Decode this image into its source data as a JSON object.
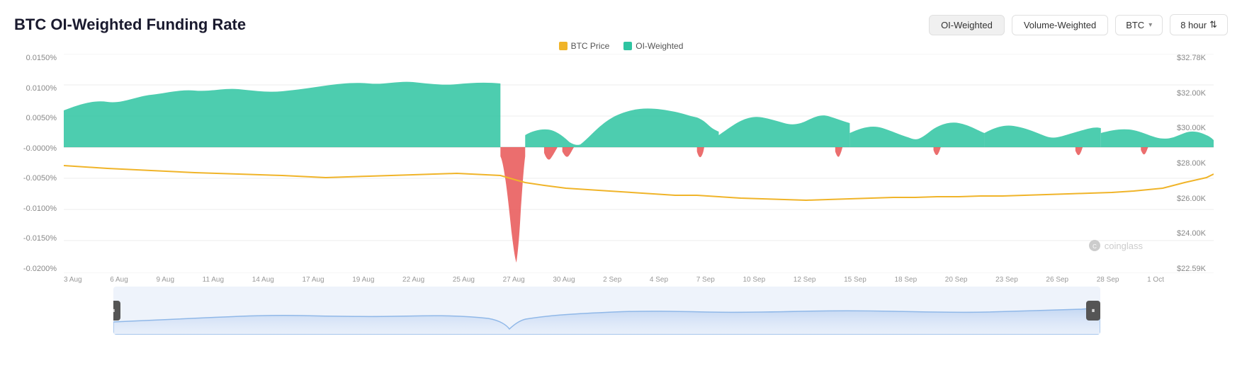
{
  "title": "BTC OI-Weighted Funding Rate",
  "controls": {
    "oi_weighted_label": "OI-Weighted",
    "volume_weighted_label": "Volume-Weighted",
    "coin_label": "BTC",
    "interval_label": "8 hour",
    "coin_arrow": "▾",
    "interval_arrows": "⇅"
  },
  "legend": {
    "btc_price_label": "BTC Price",
    "oi_weighted_label": "OI-Weighted",
    "btc_price_color": "#f0b429",
    "oi_weighted_color": "#2ec4a1"
  },
  "y_axis_left": [
    "0.0150%",
    "0.0100%",
    "0.0050%",
    "-0.0000%",
    "-0.0050%",
    "-0.0100%",
    "-0.0150%",
    "-0.0200%"
  ],
  "y_axis_right": [
    "$32.78K",
    "$32.00K",
    "$30.00K",
    "$28.00K",
    "$26.00K",
    "$24.00K",
    "$22.59K"
  ],
  "x_axis": [
    "3 Aug",
    "6 Aug",
    "9 Aug",
    "11 Aug",
    "14 Aug",
    "17 Aug",
    "19 Aug",
    "22 Aug",
    "25 Aug",
    "27 Aug",
    "30 Aug",
    "2 Sep",
    "4 Sep",
    "7 Sep",
    "10 Sep",
    "12 Sep",
    "15 Sep",
    "18 Sep",
    "20 Sep",
    "23 Sep",
    "26 Sep",
    "28 Sep",
    "1 Oct"
  ],
  "watermark": "coinglass"
}
